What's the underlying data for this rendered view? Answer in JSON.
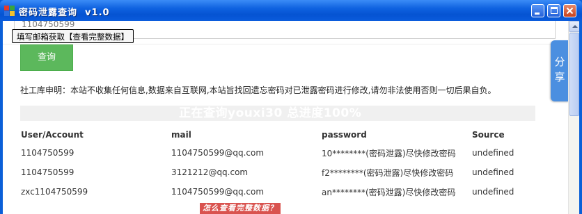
{
  "window": {
    "title": "密码泄露查询  v1.0"
  },
  "form": {
    "email_value": "1104750599",
    "hint": "填写邮箱获取【查看完整数据】",
    "query_label": "查询"
  },
  "disclaimer": "社工库申明：本站不收集任何信息,数据来自互联网,本站旨找回遗忘密码对已泄露密码进行修改,请勿非法使用否则一切后果自负。",
  "progress": {
    "text": "正在查询youxi30 总进度100%",
    "percent": 100
  },
  "table": {
    "headers": [
      "User/Account",
      "mail",
      "password",
      "Source"
    ],
    "rows": [
      [
        "1104750599",
        "1104750599@qq.com",
        "10********(密码泄露)尽快修改密码",
        "undefined"
      ],
      [
        "1104750599",
        "3121212@qq.com",
        "f2********(密码泄露)尽快修改密码",
        "undefined"
      ],
      [
        "zxc1104750599",
        "1104750599@qq.com",
        "an********(密码泄露)尽快修改密码",
        "undefined"
      ]
    ]
  },
  "help_banner": "怎么查看完整数据？",
  "share": {
    "label_1": "分",
    "label_2": "享"
  },
  "colors": {
    "title_bar": "#0553d2",
    "query_button": "#5cb85c",
    "share_tab": "#4b8fe0",
    "help_banner": "#d9534f"
  }
}
